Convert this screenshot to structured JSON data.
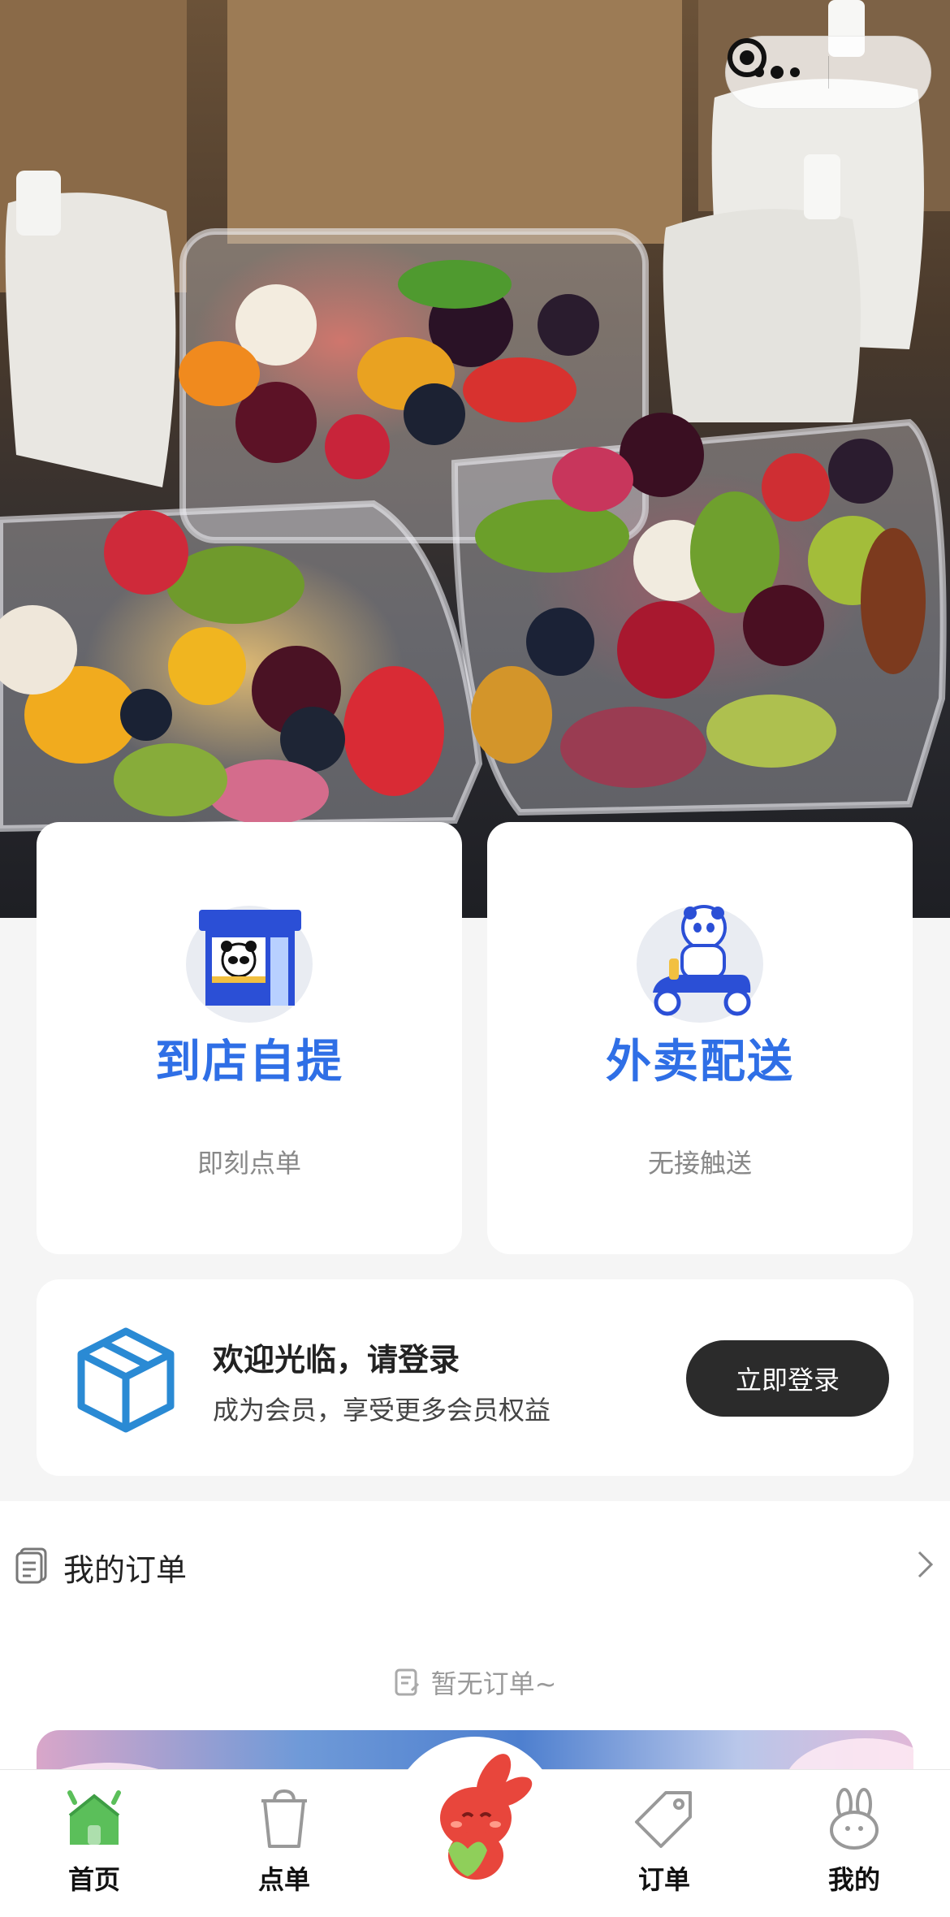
{
  "capsule": {
    "more_icon": "more-dots-icon",
    "close_icon": "target-close-icon"
  },
  "service_modes": [
    {
      "title": "到店自提",
      "subtitle": "即刻点单",
      "icon": "store-panda-icon"
    },
    {
      "title": "外卖配送",
      "subtitle": "无接触送",
      "icon": "scooter-panda-icon"
    }
  ],
  "login": {
    "title": "欢迎光临，请登录",
    "subtitle": "成为会员，享受更多会员权益",
    "button": "立即登录",
    "icon": "box-icon"
  },
  "orders": {
    "title": "我的订单",
    "empty_text": "暂无订单~"
  },
  "tabbar": {
    "items": [
      {
        "label": "首页",
        "icon": "home-icon",
        "active": true
      },
      {
        "label": "点单",
        "icon": "cup-icon"
      },
      {
        "label": "订单",
        "icon": "tag-icon"
      },
      {
        "label": "我的",
        "icon": "rabbit-icon"
      }
    ],
    "center_icon": "red-rabbit-mascot-icon"
  },
  "colors": {
    "accent_blue": "#2f6fe6",
    "button_dark": "#2b2b2b",
    "home_green": "#5bbf5a",
    "mascot_red": "#e8463c"
  }
}
